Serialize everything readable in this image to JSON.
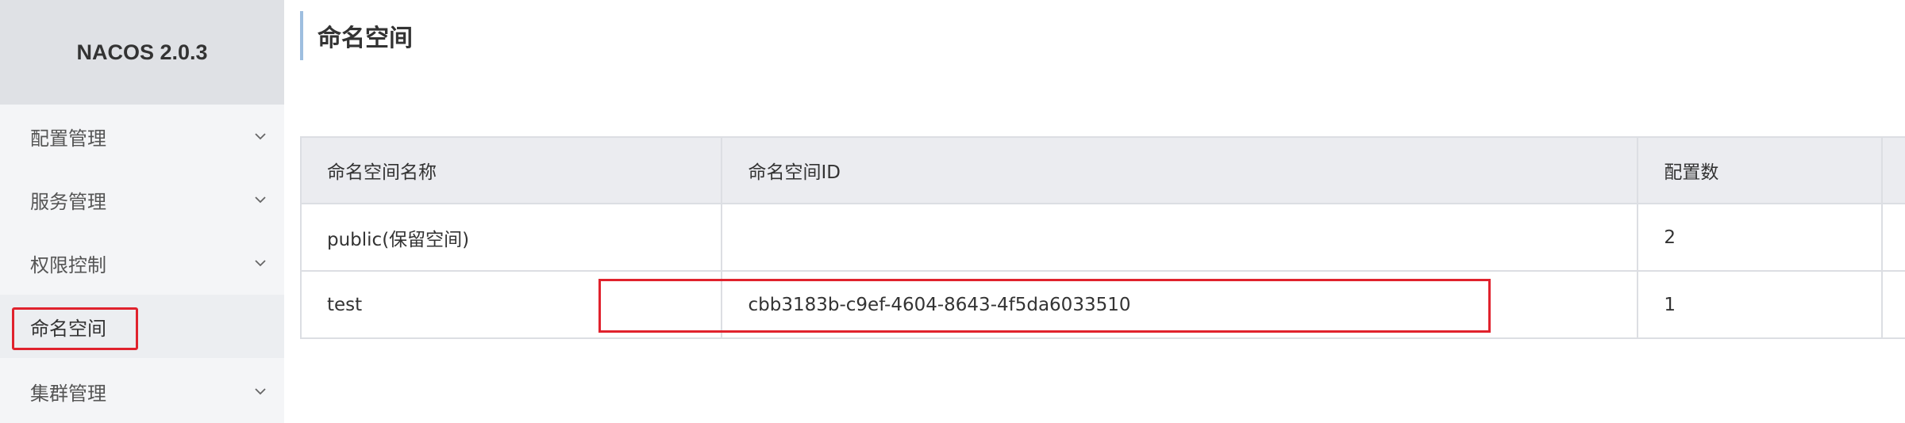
{
  "brand": {
    "name": "NACOS 2.0.3"
  },
  "sidebar": {
    "items": [
      {
        "label": "配置管理",
        "expandable": true
      },
      {
        "label": "服务管理",
        "expandable": true
      },
      {
        "label": "权限控制",
        "expandable": true
      },
      {
        "label": "命名空间",
        "expandable": false,
        "active": true
      },
      {
        "label": "集群管理",
        "expandable": true
      }
    ]
  },
  "page": {
    "title": "命名空间"
  },
  "table": {
    "headers": [
      "命名空间名称",
      "命名空间ID",
      "配置数",
      ""
    ],
    "rows": [
      {
        "name": "public(保留空间)",
        "id": "",
        "count": "2"
      },
      {
        "name": "test",
        "id": "cbb3183b-c9ef-4604-8643-4f5da6033510",
        "count": "1"
      }
    ]
  },
  "colors": {
    "highlight": "#e0222d",
    "title_accent": "#9ebedf",
    "sidebar_bg": "#f4f5f7",
    "brand_bg": "#dfe1e5",
    "header_bg": "#ebecf0"
  },
  "icons": {
    "expand": "chevron-down-icon"
  }
}
